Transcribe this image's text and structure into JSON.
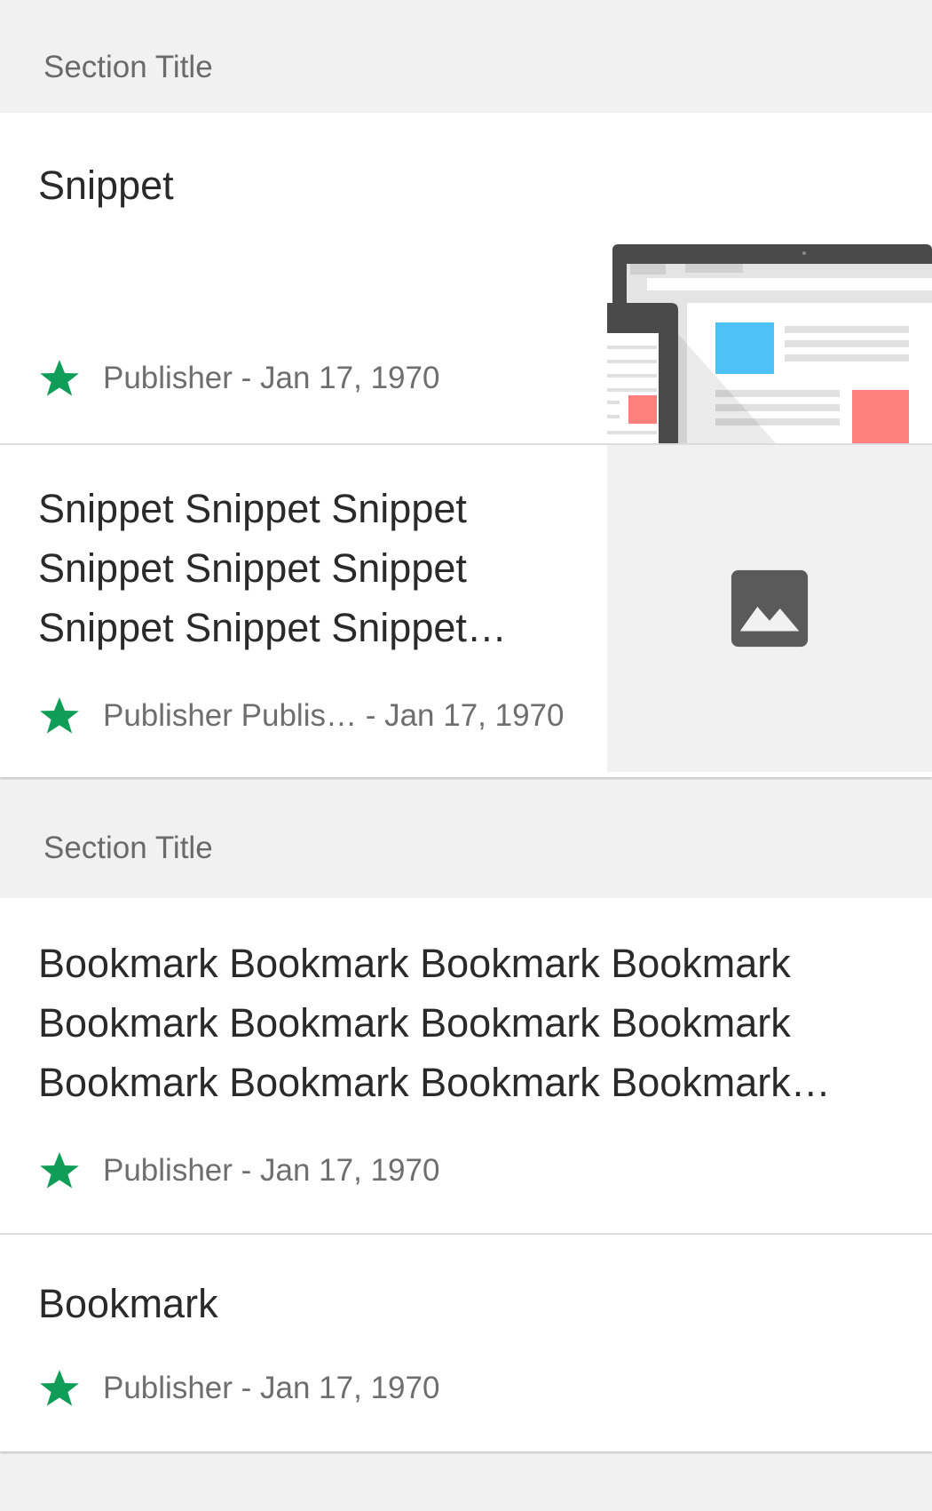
{
  "sections": [
    {
      "title": "Section Title",
      "cards": [
        {
          "text": "Snippet",
          "publisher": "Publisher",
          "date": "Jan 17, 1970",
          "thumbnail": "laptop-illustration"
        },
        {
          "text_lines": [
            "Snippet Snippet Snippet",
            "Snippet Snippet Snippet",
            "Snippet Snippet Snippet…"
          ],
          "publisher": "Publisher Publis…",
          "date": "Jan 17, 1970",
          "thumbnail": "image-placeholder-icon"
        }
      ]
    },
    {
      "title": "Section Title",
      "cards": [
        {
          "text_lines": [
            "Bookmark Bookmark Bookmark Bookmark",
            "Bookmark Bookmark Bookmark Bookmark",
            "Bookmark Bookmark Bookmark Bookmark…"
          ],
          "publisher": "Publisher",
          "date": "Jan 17, 1970"
        },
        {
          "text": "Bookmark",
          "publisher": "Publisher",
          "date": "Jan 17, 1970"
        }
      ]
    }
  ],
  "meta_separator": " - ",
  "colors": {
    "star": "#0f9d58",
    "background": "#f1f1f1",
    "card": "#ffffff",
    "blue_tile": "#4fc3f7",
    "red_tile": "#ff7e7e"
  },
  "icons": {
    "star": "star-icon",
    "image": "image-icon"
  }
}
